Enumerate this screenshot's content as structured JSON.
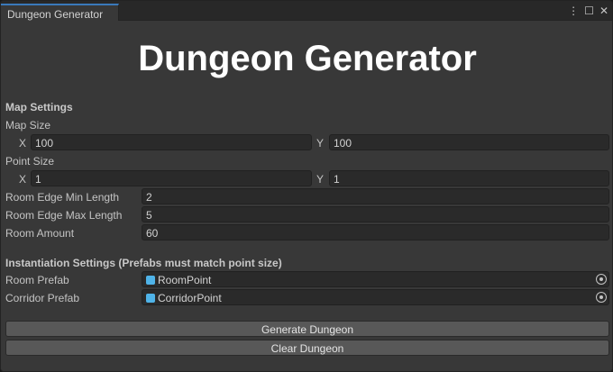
{
  "window": {
    "tab_title": "Dungeon Generator",
    "menu_icon": "⋮",
    "maximize_icon": "☐",
    "close_icon": "✕"
  },
  "header": {
    "title": "Dungeon Generator"
  },
  "map_settings": {
    "heading": "Map Settings",
    "map_size": {
      "label": "Map Size",
      "x_label": "X",
      "x": "100",
      "y_label": "Y",
      "y": "100"
    },
    "point_size": {
      "label": "Point Size",
      "x_label": "X",
      "x": "1",
      "y_label": "Y",
      "y": "1"
    },
    "room_edge_min": {
      "label": "Room Edge Min Length",
      "value": "2"
    },
    "room_edge_max": {
      "label": "Room Edge Max Length",
      "value": "5"
    },
    "room_amount": {
      "label": "Room Amount",
      "value": "60"
    }
  },
  "instantiation": {
    "heading": "Instantiation Settings (Prefabs must match point size)",
    "room_prefab": {
      "label": "Room Prefab",
      "value": "RoomPoint"
    },
    "corridor_prefab": {
      "label": "Corridor Prefab",
      "value": "CorridorPoint"
    }
  },
  "buttons": {
    "generate": "Generate Dungeon",
    "clear": "Clear Dungeon"
  }
}
